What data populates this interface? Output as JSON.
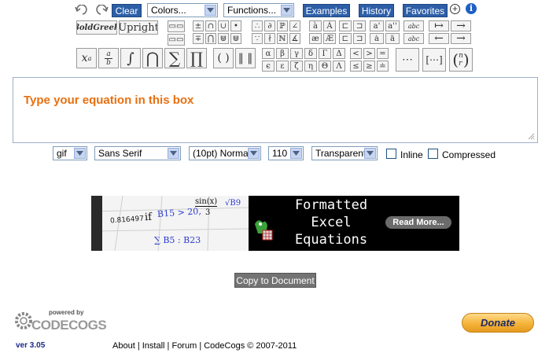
{
  "toolbar": {
    "undo_icon": "undo-icon",
    "redo_icon": "redo-icon",
    "clear_label": "Clear",
    "colors_value": "Colors...",
    "functions_value": "Functions...",
    "examples_label": "Examples",
    "history_label": "History",
    "favorites_label": "Favorites",
    "plus_icon": "⊕",
    "info_icon": "i"
  },
  "palette": {
    "bold_greek": "βoldGreek",
    "upright": "Upright",
    "superscript": "x",
    "superscript_exp": "a",
    "fraction_num": "a",
    "fraction_den": "b",
    "integral": "∫",
    "bigcap": "⋂",
    "sum": "∑",
    "prod": "∏",
    "parens": "( )",
    "norm": "‖ ‖",
    "row1_set1": [
      "±",
      "∩",
      "∪",
      "•",
      "∴",
      "∂",
      "ℙ",
      "∠"
    ],
    "row2_set1": [
      "∓",
      "⋂",
      "⋓",
      "⋓",
      "∵",
      "∤",
      "ℕ",
      "∡"
    ],
    "accents1": [
      "à",
      "Á",
      "æ",
      "Æ"
    ],
    "primes": [
      "a'",
      "a''",
      "ȧ",
      "ä"
    ],
    "overs": [
      "abc",
      "abc"
    ],
    "arrows": [
      "↦",
      "→",
      "←",
      "→"
    ],
    "greek_lower": [
      "α",
      "β",
      "γ",
      "δ"
    ],
    "greek_lower2": [
      "ϵ",
      "ε",
      "ζ",
      "η"
    ],
    "greek_upper": [
      "Γ",
      "Δ"
    ],
    "greek_upper2": [
      "Θ",
      "Λ"
    ],
    "relations": [
      "<",
      ">",
      "=",
      "≤",
      "≥",
      "≐"
    ],
    "dots": "⋯",
    "matrix": "[⋯]",
    "binom_top": "n",
    "binom_bot": "r"
  },
  "editor": {
    "placeholder": "Type your equation in this box"
  },
  "options": {
    "format": "gif",
    "font": "Sans Serif",
    "size": "(10pt) Normal",
    "dpi": "110",
    "background": "Transparent",
    "inline_label": "Inline",
    "compressed_label": "Compressed"
  },
  "banner": {
    "formula_number": "0.816497",
    "formula_if": "if",
    "formula_b15": "B15 > 20,",
    "formula_sin": "sin(x)",
    "formula_three": "3",
    "formula_sqrt": "√B9",
    "formula_sum": "∑ B5 : B23",
    "heading_line1": "Formatted",
    "heading_line2": "Excel",
    "heading_line3": "Equations",
    "read_more": "Read More..."
  },
  "copy_button": "Copy to Document",
  "logo": {
    "powered_by": "powered by",
    "brand": "CODECOGS"
  },
  "donate_label": "Donate",
  "footer": {
    "version": "ver 3.05",
    "about": "About",
    "install": "Install",
    "forum": "Forum",
    "copyright": "CodeCogs © 2007-2011"
  },
  "colors": {
    "accent_blue": "#2d5fa8",
    "placeholder_orange": "#e87010",
    "version_blue": "#1a2a8a",
    "donate_yellow": "#f5b43a"
  }
}
